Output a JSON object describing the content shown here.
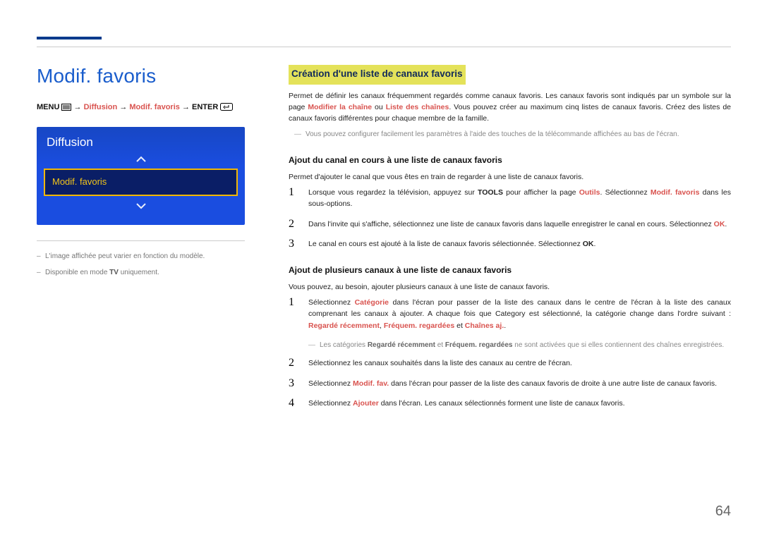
{
  "page": {
    "number": "64"
  },
  "left": {
    "title": "Modif. favoris",
    "breadcrumb": {
      "menu_label": "MENU",
      "arrow": "→",
      "diffusion": "Diffusion",
      "modif": "Modif. favoris",
      "enter_label": "ENTER"
    },
    "widget": {
      "head": "Diffusion",
      "selected": "Modif. favoris"
    },
    "footnotes": {
      "f1_pre": "L'image affichée peut varier en fonction du modèle.",
      "f2_pre": "Disponible en mode ",
      "f2_tv": "TV",
      "f2_post": " uniquement."
    }
  },
  "right": {
    "h1": "Création d'une liste de canaux favoris",
    "intro_1a": "Permet de définir les canaux fréquemment regardés comme canaux favoris. Les canaux favoris sont indiqués par un symbole sur la page ",
    "intro_1_mc": "Modifier la chaîne",
    "intro_1_ou": " ou ",
    "intro_1_lc": "Liste des chaînes",
    "intro_1b": ". Vous pouvez créer au maximum cinq listes de canaux favoris. Créez des listes de canaux favoris différentes pour chaque membre de la famille.",
    "note1": "Vous pouvez configurer facilement les paramètres à l'aide des touches de la télécommande affichées au bas de l'écran.",
    "sub1": "Ajout du canal en cours à une liste de canaux favoris",
    "sub1_intro": "Permet d'ajouter le canal que vous êtes en train de regarder à une liste de canaux favoris.",
    "s1_1a": "Lorsque vous regardez la télévision, appuyez sur ",
    "s1_1_tools": "TOOLS",
    "s1_1b": " pour afficher la page ",
    "s1_1_out": "Outils",
    "s1_1c": ". Sélectionnez ",
    "s1_1_mf": "Modif. favoris",
    "s1_1d": " dans les sous-options.",
    "s1_2a": "Dans l'invite qui s'affiche, sélectionnez une liste de canaux favoris dans laquelle enregistrer le canal en cours. Sélectionnez ",
    "s1_2_ok": "OK",
    "s1_2b": ".",
    "s1_3a": "Le canal en cours est ajouté à la liste de canaux favoris sélectionnée. Sélectionnez ",
    "s1_3_ok": "OK",
    "s1_3b": ".",
    "sub2": "Ajout de plusieurs canaux à une liste de canaux favoris",
    "sub2_intro": "Vous pouvez, au besoin, ajouter plusieurs canaux à une liste de canaux favoris.",
    "s2_1a": "Sélectionnez ",
    "s2_1_cat": "Catégorie",
    "s2_1b": " dans l'écran pour passer de la liste des canaux dans le centre de l'écran à la liste des canaux comprenant les canaux à ajouter. A chaque fois que Category est sélectionné, la catégorie change dans l'ordre suivant : ",
    "s2_1_r1": "Regardé récemment",
    "s2_1_sep": ", ",
    "s2_1_r2": "Fréquem. regardées",
    "s2_1_et": " et ",
    "s2_1_r3": "Chaînes aj.",
    "s2_1_end": ".",
    "s2_note_a": "Les catégories ",
    "s2_note_b1": "Regardé récemment",
    "s2_note_mid": " et ",
    "s2_note_b2": "Fréquem. regardées",
    "s2_note_c": " ne sont activées que si elles contiennent des chaînes enregistrées.",
    "s2_2": "Sélectionnez les canaux souhaités dans la liste des canaux au centre de l'écran.",
    "s2_3a": "Sélectionnez ",
    "s2_3_mf": "Modif. fav.",
    "s2_3b": " dans l'écran pour passer de la liste des canaux favoris de droite à une autre liste de canaux favoris.",
    "s2_4a": "Sélectionnez ",
    "s2_4_aj": "Ajouter",
    "s2_4b": " dans l'écran. Les canaux sélectionnés forment une liste de canaux favoris."
  }
}
